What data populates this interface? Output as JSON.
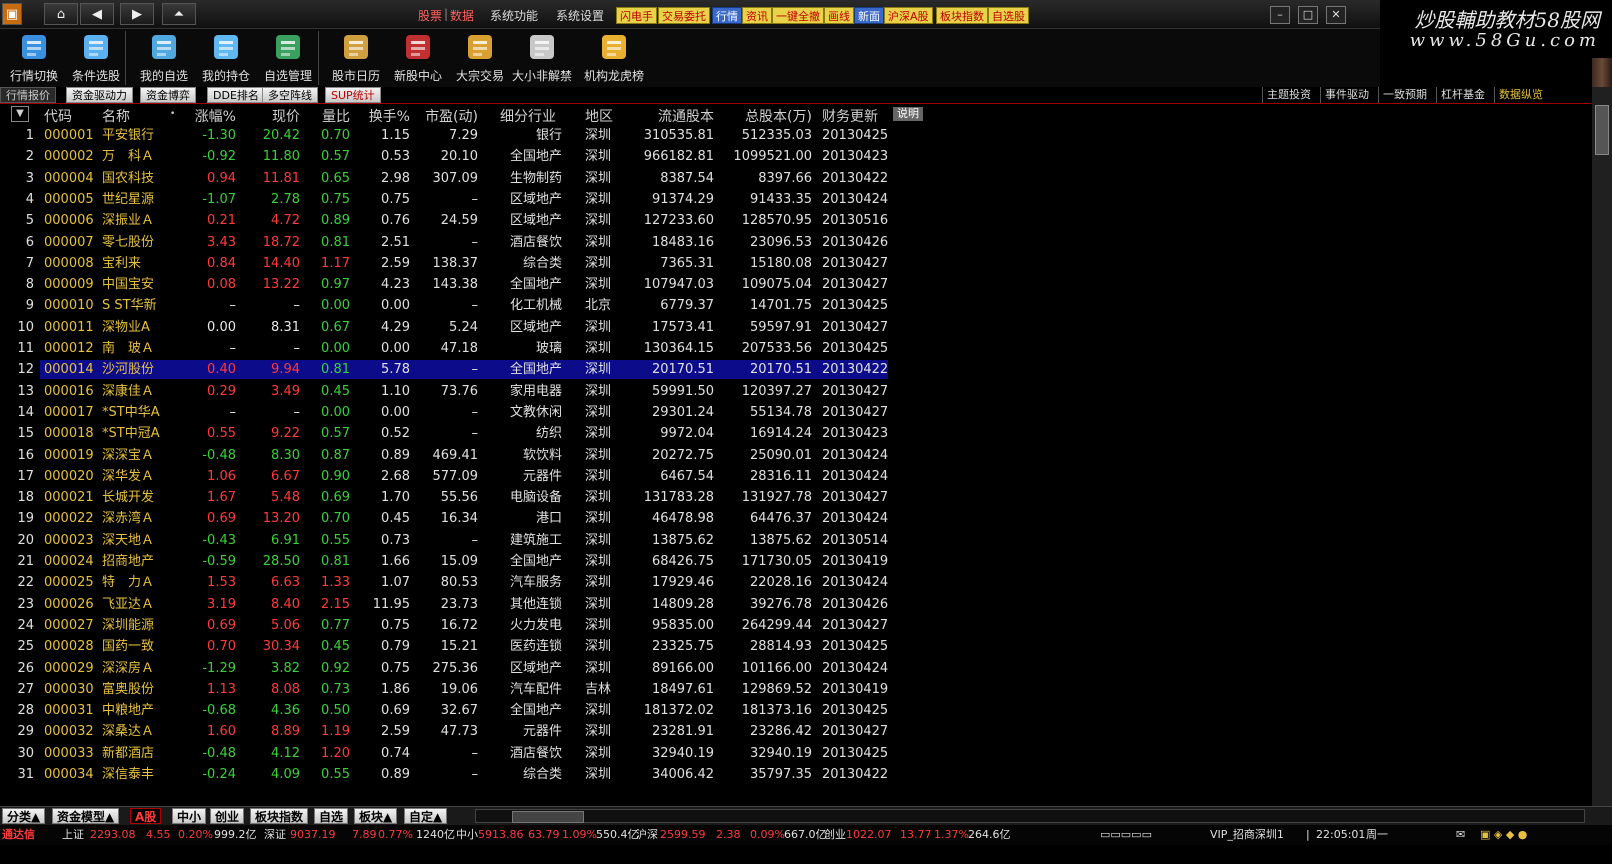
{
  "menu": {
    "nav_icons": [
      "app-logo-icon",
      "home-icon",
      "back-icon",
      "forward-icon",
      "collapse-up-icon"
    ],
    "items": [
      {
        "label": "股票",
        "active": true
      },
      {
        "label": "数据",
        "active": true
      },
      {
        "label": "系统功能",
        "active": false
      },
      {
        "label": "系统设置",
        "active": false
      }
    ],
    "quick_buttons": [
      {
        "label": "闪电手",
        "blue": false
      },
      {
        "label": "交易委托",
        "blue": false
      },
      {
        "label": "行情",
        "blue": true
      },
      {
        "label": "资讯",
        "blue": false
      },
      {
        "label": "一键全撤",
        "blue": false
      },
      {
        "label": "画线",
        "blue": false
      },
      {
        "label": "新面",
        "blue": true
      },
      {
        "label": "沪深A股",
        "blue": false
      },
      {
        "label": "板块指数",
        "blue": false
      },
      {
        "label": "自选股",
        "blue": false
      }
    ],
    "window_buttons": [
      "–",
      "□",
      "✕"
    ]
  },
  "watermark": {
    "line1": "炒股輔助教材58股网",
    "line2": "www.58Gu.com"
  },
  "toolbar": [
    {
      "label": "行情切换",
      "icon": "switch-icon"
    },
    {
      "label": "条件选股",
      "icon": "search-stock-icon"
    },
    {
      "label": "我的自选",
      "icon": "my-watchlist-icon"
    },
    {
      "label": "我的持仓",
      "icon": "cart-icon"
    },
    {
      "label": "自选管理",
      "icon": "watchlist-manage-icon"
    },
    {
      "label": "股市日历",
      "icon": "calendar-icon"
    },
    {
      "label": "新股中心",
      "icon": "new-stock-icon"
    },
    {
      "label": "大宗交易",
      "icon": "block-trade-icon"
    },
    {
      "label": "大小非解禁",
      "icon": "lock-icon"
    },
    {
      "label": "机构龙虎榜",
      "icon": "medal-icon"
    }
  ],
  "tabs": [
    "行情报价",
    "资金驱动力",
    "资金博弈",
    "DDE排名",
    "多空阵线",
    "SUP统计"
  ],
  "right_tabs": [
    "主题投资",
    "事件驱动",
    "一致预期",
    "杠杆基金",
    "数据纵览"
  ],
  "table": {
    "headers": {
      "idx": "▼",
      "code": "代码",
      "name": "名称",
      "chg": "涨幅%",
      "price": "现价",
      "vr": "量比",
      "turn": "换手%",
      "pe": "市盈(动)",
      "ind": "细分行业",
      "area": "地区",
      "float": "流通股本",
      "total": "总股本(万)",
      "upd": "财务更新",
      "help": "说明"
    },
    "rows": [
      [
        "1",
        "000001",
        "平安银行",
        "-1.30",
        "20.42",
        "0.70",
        "1.15",
        "7.29",
        "银行",
        "深圳",
        "310535.81",
        "512335.03",
        "20130425"
      ],
      [
        "2",
        "000002",
        "万　科Ａ",
        "-0.92",
        "11.80",
        "0.57",
        "0.53",
        "20.10",
        "全国地产",
        "深圳",
        "966182.81",
        "1099521.00",
        "20130423"
      ],
      [
        "3",
        "000004",
        "国农科技",
        "0.94",
        "11.81",
        "0.65",
        "2.98",
        "307.09",
        "生物制药",
        "深圳",
        "8387.54",
        "8397.66",
        "20130422"
      ],
      [
        "4",
        "000005",
        "世纪星源",
        "-1.07",
        "2.78",
        "0.75",
        "0.75",
        "–",
        "区域地产",
        "深圳",
        "91374.29",
        "91433.35",
        "20130424"
      ],
      [
        "5",
        "000006",
        "深振业Ａ",
        "0.21",
        "4.72",
        "0.89",
        "0.76",
        "24.59",
        "区域地产",
        "深圳",
        "127233.60",
        "128570.95",
        "20130516"
      ],
      [
        "6",
        "000007",
        "零七股份",
        "3.43",
        "18.72",
        "0.81",
        "2.51",
        "–",
        "酒店餐饮",
        "深圳",
        "18483.16",
        "23096.53",
        "20130426"
      ],
      [
        "7",
        "000008",
        "宝利来",
        "0.84",
        "14.40",
        "1.17",
        "2.59",
        "138.37",
        "综合类",
        "深圳",
        "7365.31",
        "15180.08",
        "20130427"
      ],
      [
        "8",
        "000009",
        "中国宝安",
        "0.08",
        "13.22",
        "0.97",
        "4.23",
        "143.38",
        "全国地产",
        "深圳",
        "107947.03",
        "109075.04",
        "20130427"
      ],
      [
        "9",
        "000010",
        "S ST华新",
        "–",
        "–",
        "0.00",
        "0.00",
        "–",
        "化工机械",
        "北京",
        "6779.37",
        "14701.75",
        "20130425"
      ],
      [
        "10",
        "000011",
        "深物业A",
        "0.00",
        "8.31",
        "0.67",
        "4.29",
        "5.24",
        "区域地产",
        "深圳",
        "17573.41",
        "59597.91",
        "20130427"
      ],
      [
        "11",
        "000012",
        "南　玻Ａ",
        "–",
        "–",
        "0.00",
        "0.00",
        "47.18",
        "玻璃",
        "深圳",
        "130364.15",
        "207533.56",
        "20130425"
      ],
      [
        "12",
        "000014",
        "沙河股份",
        "0.40",
        "9.94",
        "0.81",
        "5.78",
        "–",
        "全国地产",
        "深圳",
        "20170.51",
        "20170.51",
        "20130422"
      ],
      [
        "13",
        "000016",
        "深康佳Ａ",
        "0.29",
        "3.49",
        "0.45",
        "1.10",
        "73.76",
        "家用电器",
        "深圳",
        "59991.50",
        "120397.27",
        "20130427"
      ],
      [
        "14",
        "000017",
        "*ST中华A",
        "–",
        "–",
        "0.00",
        "0.00",
        "–",
        "文教休闲",
        "深圳",
        "29301.24",
        "55134.78",
        "20130427"
      ],
      [
        "15",
        "000018",
        "*ST中冠A",
        "0.55",
        "9.22",
        "0.57",
        "0.52",
        "–",
        "纺织",
        "深圳",
        "9972.04",
        "16914.24",
        "20130423"
      ],
      [
        "16",
        "000019",
        "深深宝Ａ",
        "-0.48",
        "8.30",
        "0.87",
        "0.89",
        "469.41",
        "软饮料",
        "深圳",
        "20272.75",
        "25090.01",
        "20130424"
      ],
      [
        "17",
        "000020",
        "深华发Ａ",
        "1.06",
        "6.67",
        "0.90",
        "2.68",
        "577.09",
        "元器件",
        "深圳",
        "6467.54",
        "28316.11",
        "20130424"
      ],
      [
        "18",
        "000021",
        "长城开发",
        "1.67",
        "5.48",
        "0.69",
        "1.70",
        "55.56",
        "电脑设备",
        "深圳",
        "131783.28",
        "131927.78",
        "20130427"
      ],
      [
        "19",
        "000022",
        "深赤湾Ａ",
        "0.69",
        "13.20",
        "0.70",
        "0.45",
        "16.34",
        "港口",
        "深圳",
        "46478.98",
        "64476.37",
        "20130424"
      ],
      [
        "20",
        "000023",
        "深天地Ａ",
        "-0.43",
        "6.91",
        "0.55",
        "0.73",
        "–",
        "建筑施工",
        "深圳",
        "13875.62",
        "13875.62",
        "20130514"
      ],
      [
        "21",
        "000024",
        "招商地产",
        "-0.59",
        "28.50",
        "0.81",
        "1.66",
        "15.09",
        "全国地产",
        "深圳",
        "68426.75",
        "171730.05",
        "20130419"
      ],
      [
        "22",
        "000025",
        "特　力Ａ",
        "1.53",
        "6.63",
        "1.33",
        "1.07",
        "80.53",
        "汽车服务",
        "深圳",
        "17929.46",
        "22028.16",
        "20130424"
      ],
      [
        "23",
        "000026",
        "飞亚达Ａ",
        "3.19",
        "8.40",
        "2.15",
        "11.95",
        "23.73",
        "其他连锁",
        "深圳",
        "14809.28",
        "39276.78",
        "20130426"
      ],
      [
        "24",
        "000027",
        "深圳能源",
        "0.69",
        "5.06",
        "0.77",
        "0.75",
        "16.72",
        "火力发电",
        "深圳",
        "95835.00",
        "264299.44",
        "20130427"
      ],
      [
        "25",
        "000028",
        "国药一致",
        "0.70",
        "30.34",
        "0.45",
        "0.79",
        "15.21",
        "医药连锁",
        "深圳",
        "23325.75",
        "28814.93",
        "20130425"
      ],
      [
        "26",
        "000029",
        "深深房Ａ",
        "-1.29",
        "3.82",
        "0.92",
        "0.75",
        "275.36",
        "区域地产",
        "深圳",
        "89166.00",
        "101166.00",
        "20130424"
      ],
      [
        "27",
        "000030",
        "富奥股份",
        "1.13",
        "8.08",
        "0.73",
        "1.86",
        "19.06",
        "汽车配件",
        "吉林",
        "18497.61",
        "129869.52",
        "20130419"
      ],
      [
        "28",
        "000031",
        "中粮地产",
        "-0.68",
        "4.36",
        "0.50",
        "0.69",
        "32.67",
        "全国地产",
        "深圳",
        "181372.02",
        "181373.16",
        "20130425"
      ],
      [
        "29",
        "000032",
        "深桑达Ａ",
        "1.60",
        "8.89",
        "1.19",
        "2.59",
        "47.73",
        "元器件",
        "深圳",
        "23281.91",
        "23286.42",
        "20130427"
      ],
      [
        "30",
        "000033",
        "新都酒店",
        "-0.48",
        "4.12",
        "1.20",
        "0.74",
        "–",
        "酒店餐饮",
        "深圳",
        "32940.19",
        "32940.19",
        "20130425"
      ],
      [
        "31",
        "000034",
        "深信泰丰",
        "-0.24",
        "4.09",
        "0.55",
        "0.89",
        "–",
        "综合类",
        "深圳",
        "34006.42",
        "35797.35",
        "20130422"
      ]
    ],
    "selected_row": 12,
    "colors": {
      "up": "#ff3a3a",
      "down": "#3ad03a",
      "flat": "#e8e8e8",
      "code": "#e7c040",
      "name": "#e7c040",
      "industry": "#e0e0e0",
      "selected_bg": "#0c0c8a"
    }
  },
  "bottom_tabs": [
    {
      "label": "分类▲",
      "active": false
    },
    {
      "label": "资金模型▲",
      "active": false
    },
    {
      "label": "A股",
      "active": true
    },
    {
      "label": "中小",
      "active": false
    },
    {
      "label": "创业",
      "active": false
    },
    {
      "label": "板块指数",
      "active": false
    },
    {
      "label": "自选",
      "active": false
    },
    {
      "label": "板块▲",
      "active": false
    },
    {
      "label": "自定▲",
      "active": false
    }
  ],
  "status": [
    {
      "t": "通达信",
      "c": "sr"
    },
    {
      "t": "上证",
      "c": "sw"
    },
    {
      "t": "2293.08",
      "c": "sr"
    },
    {
      "t": "4.55",
      "c": "sr"
    },
    {
      "t": "0.20%",
      "c": "sr"
    },
    {
      "t": "999.2亿",
      "c": "sw"
    },
    {
      "t": "深证",
      "c": "sw"
    },
    {
      "t": "9037.19",
      "c": "sr"
    },
    {
      "t": "7.89",
      "c": "sr"
    },
    {
      "t": "0.77%",
      "c": "sr"
    },
    {
      "t": "1240亿",
      "c": "sw"
    },
    {
      "t": "中小",
      "c": "sw"
    },
    {
      "t": "5913.86",
      "c": "sr"
    },
    {
      "t": "63.79",
      "c": "sr"
    },
    {
      "t": "1.09%",
      "c": "sr"
    },
    {
      "t": "550.4亿",
      "c": "sw"
    },
    {
      "t": "沪深",
      "c": "sw"
    },
    {
      "t": "2599.59",
      "c": "sr"
    },
    {
      "t": "2.38",
      "c": "sr"
    },
    {
      "t": "0.09%",
      "c": "sr"
    },
    {
      "t": "667.0亿",
      "c": "sw"
    },
    {
      "t": "创业",
      "c": "sw"
    },
    {
      "t": "1022.07",
      "c": "sr"
    },
    {
      "t": "13.77",
      "c": "sr"
    },
    {
      "t": "1.37%",
      "c": "sr"
    },
    {
      "t": "264.6亿",
      "c": "sw"
    }
  ],
  "status_right": {
    "account": "VIP_招商深圳1",
    "time": "22:05:01",
    "weekday": "周一"
  }
}
